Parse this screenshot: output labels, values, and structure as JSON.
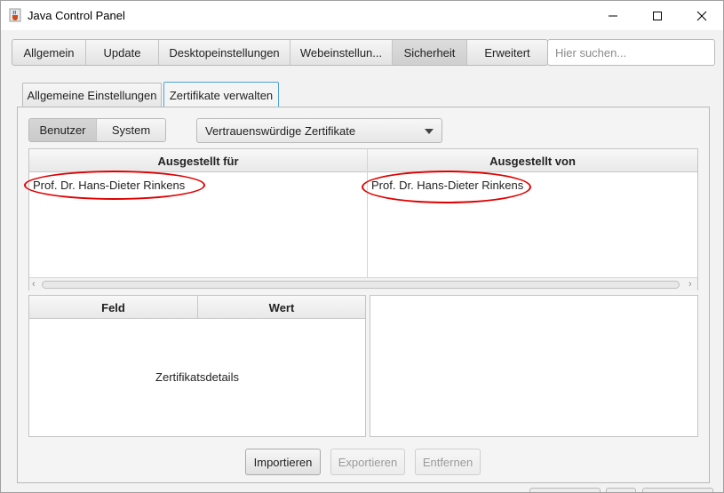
{
  "window": {
    "title": "Java Control Panel",
    "icons": [
      "java-cup-icon",
      "minimize-icon",
      "maximize-icon",
      "close-icon"
    ]
  },
  "main_tabs": [
    {
      "label": "Allgemein",
      "active": false
    },
    {
      "label": "Update",
      "active": false
    },
    {
      "label": "Desktopeinstellungen",
      "active": false
    },
    {
      "label": "Webeinstellun...",
      "active": false
    },
    {
      "label": "Sicherheit",
      "active": true
    },
    {
      "label": "Erweitert",
      "active": false
    }
  ],
  "search": {
    "placeholder": "Hier suchen...",
    "value": ""
  },
  "sub_tabs": [
    {
      "label": "Allgemeine Einstellungen",
      "active": false
    },
    {
      "label": "Zertifikate verwalten",
      "active": true
    }
  ],
  "scope_toggle": [
    {
      "label": "Benutzer",
      "active": true
    },
    {
      "label": "System",
      "active": false
    }
  ],
  "certificate_type": {
    "selected": "Vertrauenswürdige Zertifikate"
  },
  "certificate_table": {
    "columns": [
      "Ausgestellt für",
      "Ausgestellt von"
    ],
    "rows": [
      [
        "Prof. Dr. Hans-Dieter Rinkens",
        "Prof. Dr. Hans-Dieter Rinkens"
      ]
    ]
  },
  "details_table": {
    "columns": [
      "Feld",
      "Wert"
    ],
    "placeholder": "Zertifikatsdetails"
  },
  "actions": {
    "import": {
      "label": "Importieren",
      "enabled": true
    },
    "export": {
      "label": "Exportieren",
      "enabled": false
    },
    "remove": {
      "label": "Entfernen",
      "enabled": false
    }
  },
  "colors": {
    "annotation": "#e00000",
    "active_tab_border": "#4ea3d8"
  }
}
